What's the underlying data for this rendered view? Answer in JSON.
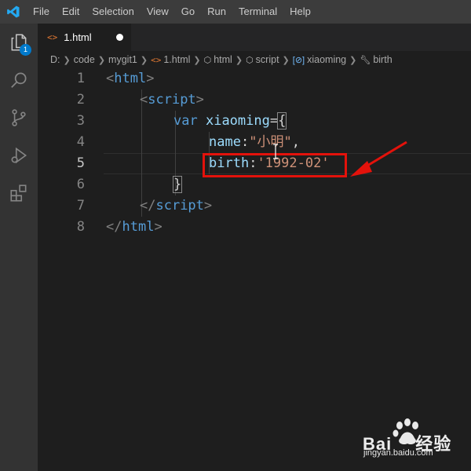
{
  "menu": [
    "File",
    "Edit",
    "Selection",
    "View",
    "Go",
    "Run",
    "Terminal",
    "Help"
  ],
  "activity": {
    "explorer_badge": "1",
    "icons": [
      "files-icon",
      "search-icon",
      "source-control-icon",
      "run-debug-icon",
      "extensions-icon"
    ]
  },
  "tab": {
    "label": "1.html",
    "icon": "<>",
    "dirty": true
  },
  "breadcrumb": {
    "items": [
      "D:",
      "code",
      "mygit1",
      "1.html",
      "html",
      "script",
      "xiaoming",
      "birth"
    ],
    "icons": [
      "",
      "",
      "",
      "html-file-icon",
      "cube-icon",
      "cube-icon",
      "variable-icon",
      "wrench-icon"
    ]
  },
  "editor": {
    "line_numbers": [
      "1",
      "2",
      "3",
      "4",
      "5",
      "6",
      "7",
      "8"
    ],
    "active_line": 5,
    "lines": {
      "l1": {
        "lt": "<",
        "tag": "html",
        "gt": ">"
      },
      "l2": {
        "lt": "<",
        "tag": "script",
        "gt": ">"
      },
      "l3": {
        "kw": "var",
        "name": "xiaoming",
        "op": "=",
        "brace": "{"
      },
      "l4": {
        "key": "name",
        "colon": ":",
        "value": "\"小明\"",
        "comma": ","
      },
      "l5": {
        "key": "birth",
        "colon": ":",
        "value": "'1992-02'"
      },
      "l6": {
        "brace": "}"
      },
      "l7": {
        "lt": "</",
        "tag": "script",
        "gt": ">"
      },
      "l8": {
        "lt": "</",
        "tag": "html",
        "gt": ">"
      }
    }
  },
  "watermark": {
    "brand": "Bai",
    "brand2": "经验",
    "url": "jingyan.baidu.com"
  },
  "colors": {
    "annotation": "#e3120b",
    "badge": "#007acc",
    "activitybar": "#333333",
    "menubar": "#3c3c3c"
  }
}
